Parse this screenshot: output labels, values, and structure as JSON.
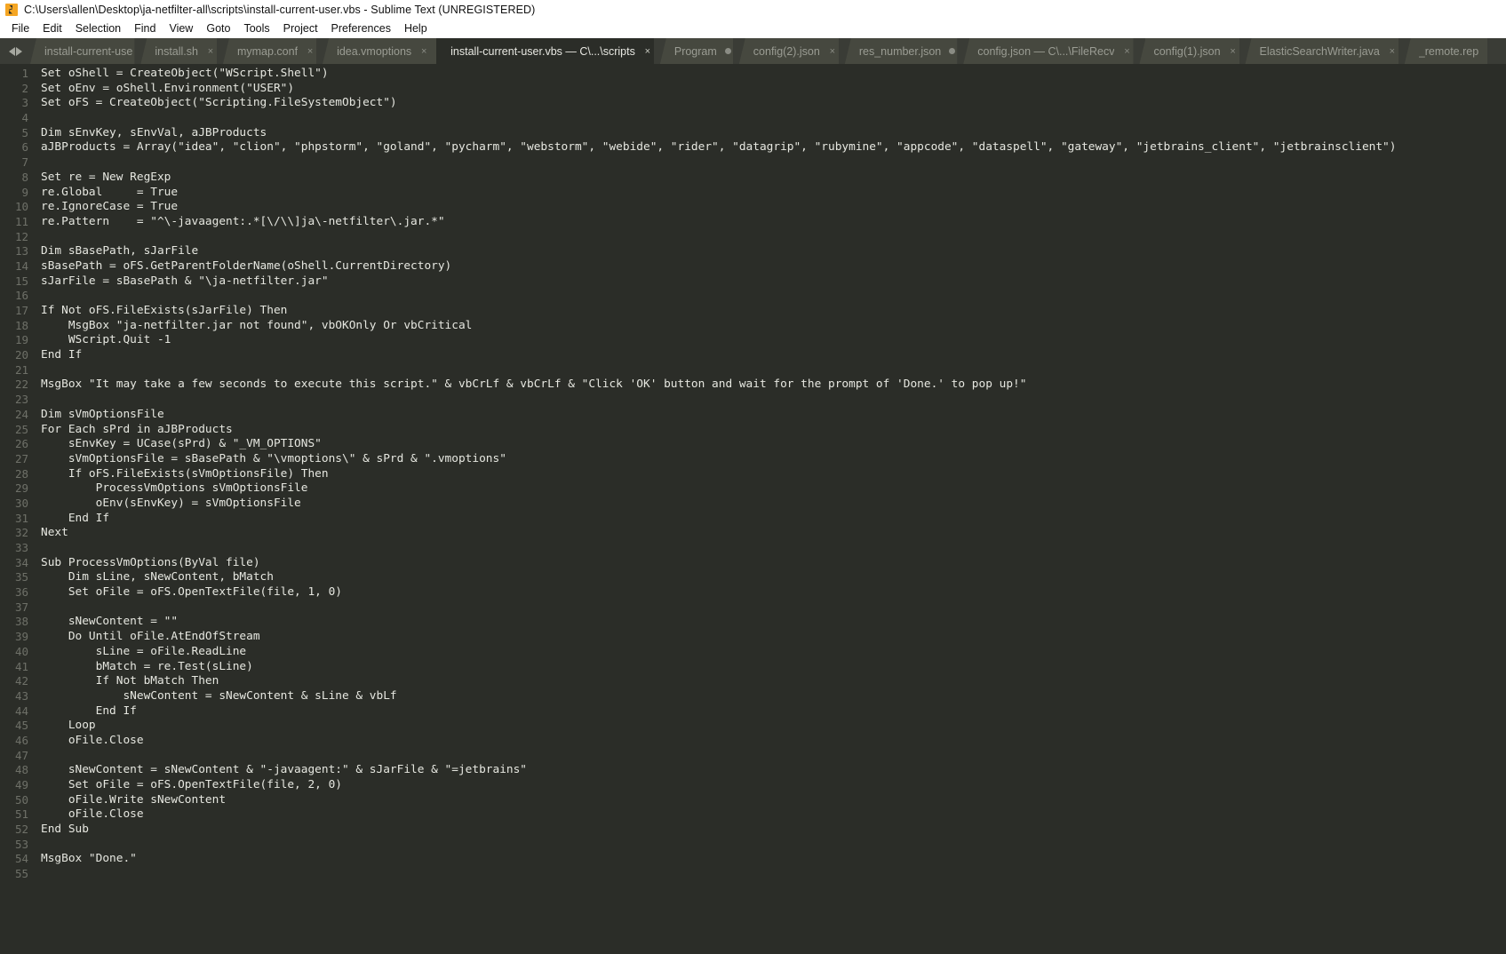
{
  "window": {
    "title": "C:\\Users\\allen\\Desktop\\ja-netfilter-all\\scripts\\install-current-user.vbs - Sublime Text (UNREGISTERED)",
    "app_icon": "sublime-text-icon"
  },
  "menu": {
    "items": [
      {
        "label": "File"
      },
      {
        "label": "Edit"
      },
      {
        "label": "Selection"
      },
      {
        "label": "Find"
      },
      {
        "label": "View"
      },
      {
        "label": "Goto"
      },
      {
        "label": "Tools"
      },
      {
        "label": "Project"
      },
      {
        "label": "Preferences"
      },
      {
        "label": "Help"
      }
    ]
  },
  "tabbar": {
    "prev_icon": "chevron-left-icon",
    "next_icon": "chevron-right-icon",
    "close_glyph": "×",
    "tabs": [
      {
        "label": "install-current-use",
        "state": "clean",
        "active": false,
        "indicator": "none"
      },
      {
        "label": "install.sh",
        "state": "clean",
        "active": false,
        "indicator": "close"
      },
      {
        "label": "mymap.conf",
        "state": "clean",
        "active": false,
        "indicator": "close"
      },
      {
        "label": "idea.vmoptions",
        "state": "clean",
        "active": false,
        "indicator": "close"
      },
      {
        "label": "install-current-user.vbs — C\\...\\scripts",
        "state": "clean",
        "active": true,
        "indicator": "close"
      },
      {
        "label": "Program",
        "state": "dirty",
        "active": false,
        "indicator": "dot"
      },
      {
        "label": "config(2).json",
        "state": "clean",
        "active": false,
        "indicator": "close"
      },
      {
        "label": "res_number.json",
        "state": "dirty",
        "active": false,
        "indicator": "dot"
      },
      {
        "label": "config.json — C\\...\\FileRecv",
        "state": "clean",
        "active": false,
        "indicator": "close"
      },
      {
        "label": "config(1).json",
        "state": "clean",
        "active": false,
        "indicator": "close"
      },
      {
        "label": "ElasticSearchWriter.java",
        "state": "clean",
        "active": false,
        "indicator": "close"
      },
      {
        "label": "_remote.rep",
        "state": "clean",
        "active": false,
        "indicator": "none"
      }
    ]
  },
  "editor": {
    "first_line_number": 1,
    "line_count": 55,
    "colors": {
      "background": "#2b2d28",
      "foreground": "#e6e7e0",
      "gutter_foreground": "#6e7068",
      "tabbar_background": "#3a3c36",
      "tab_inactive": "#46483f",
      "accent": "#f5a623"
    },
    "lines": [
      "Set oShell = CreateObject(\"WScript.Shell\")",
      "Set oEnv = oShell.Environment(\"USER\")",
      "Set oFS = CreateObject(\"Scripting.FileSystemObject\")",
      "",
      "Dim sEnvKey, sEnvVal, aJBProducts",
      "aJBProducts = Array(\"idea\", \"clion\", \"phpstorm\", \"goland\", \"pycharm\", \"webstorm\", \"webide\", \"rider\", \"datagrip\", \"rubymine\", \"appcode\", \"dataspell\", \"gateway\", \"jetbrains_client\", \"jetbrainsclient\")",
      "",
      "Set re = New RegExp",
      "re.Global     = True",
      "re.IgnoreCase = True",
      "re.Pattern    = \"^\\-javaagent:.*[\\/\\\\]ja\\-netfilter\\.jar.*\"",
      "",
      "Dim sBasePath, sJarFile",
      "sBasePath = oFS.GetParentFolderName(oShell.CurrentDirectory)",
      "sJarFile = sBasePath & \"\\ja-netfilter.jar\"",
      "",
      "If Not oFS.FileExists(sJarFile) Then",
      "    MsgBox \"ja-netfilter.jar not found\", vbOKOnly Or vbCritical",
      "    WScript.Quit -1",
      "End If",
      "",
      "MsgBox \"It may take a few seconds to execute this script.\" & vbCrLf & vbCrLf & \"Click 'OK' button and wait for the prompt of 'Done.' to pop up!\"",
      "",
      "Dim sVmOptionsFile",
      "For Each sPrd in aJBProducts",
      "    sEnvKey = UCase(sPrd) & \"_VM_OPTIONS\"",
      "    sVmOptionsFile = sBasePath & \"\\vmoptions\\\" & sPrd & \".vmoptions\"",
      "    If oFS.FileExists(sVmOptionsFile) Then",
      "        ProcessVmOptions sVmOptionsFile",
      "        oEnv(sEnvKey) = sVmOptionsFile",
      "    End If",
      "Next",
      "",
      "Sub ProcessVmOptions(ByVal file)",
      "    Dim sLine, sNewContent, bMatch",
      "    Set oFile = oFS.OpenTextFile(file, 1, 0)",
      "",
      "    sNewContent = \"\"",
      "    Do Until oFile.AtEndOfStream",
      "        sLine = oFile.ReadLine",
      "        bMatch = re.Test(sLine)",
      "        If Not bMatch Then",
      "            sNewContent = sNewContent & sLine & vbLf",
      "        End If",
      "    Loop",
      "    oFile.Close",
      "",
      "    sNewContent = sNewContent & \"-javaagent:\" & sJarFile & \"=jetbrains\"",
      "    Set oFile = oFS.OpenTextFile(file, 2, 0)",
      "    oFile.Write sNewContent",
      "    oFile.Close",
      "End Sub",
      "",
      "MsgBox \"Done.\"",
      ""
    ]
  }
}
